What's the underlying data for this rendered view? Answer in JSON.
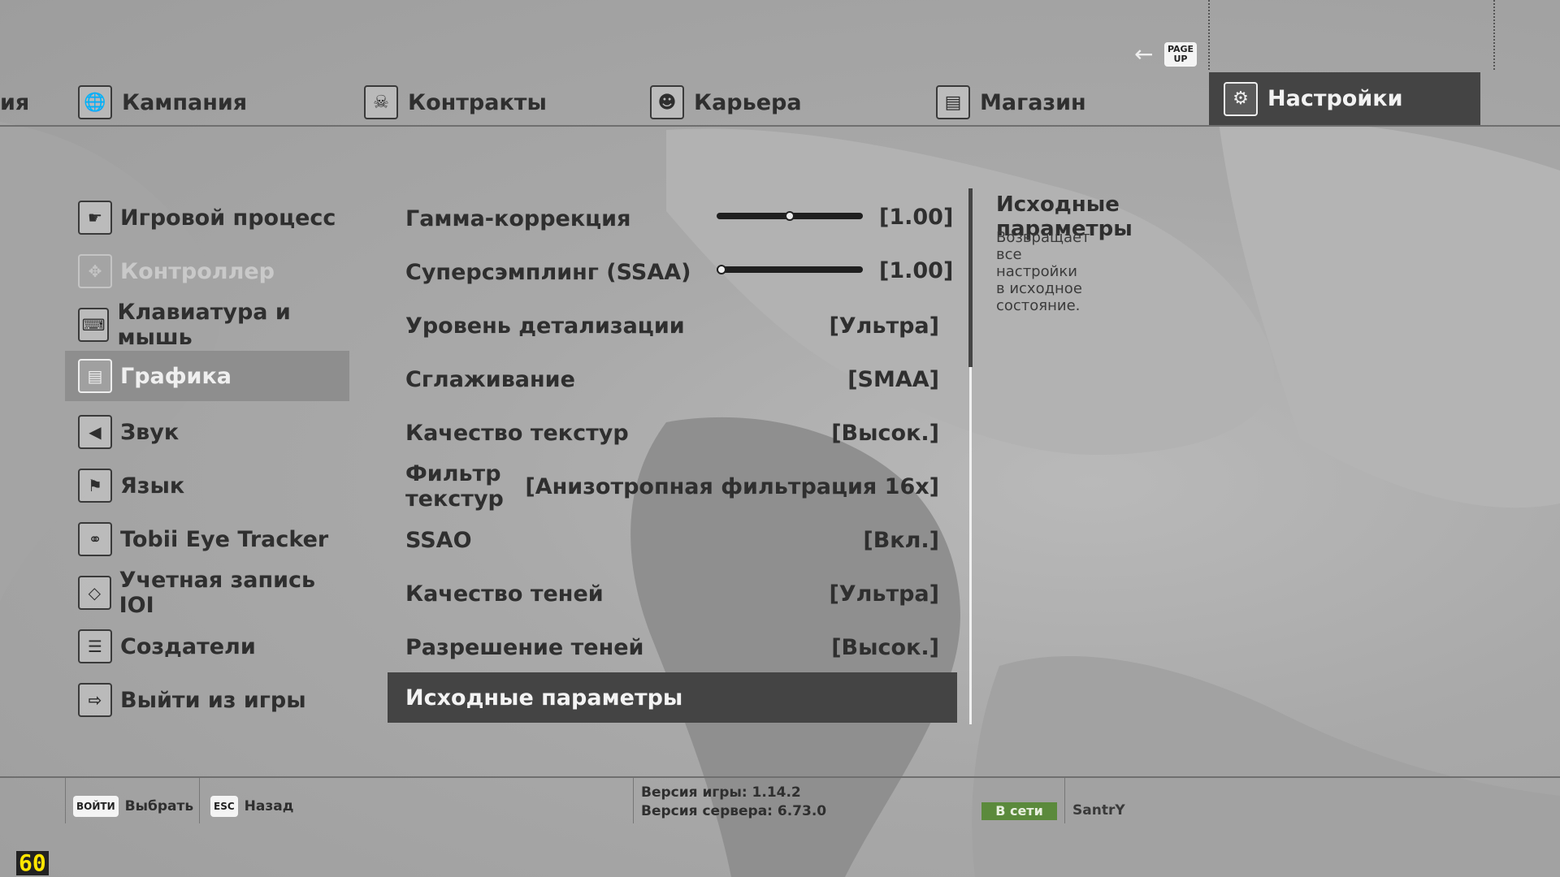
{
  "top_tabs": [
    {
      "label": "ия",
      "icon": "partial-tab"
    },
    {
      "label": "Кампания",
      "icon": "globe-icon"
    },
    {
      "label": "Контракты",
      "icon": "skull-icon"
    },
    {
      "label": "Карьера",
      "icon": "agent-icon"
    },
    {
      "label": "Магазин",
      "icon": "cart-icon"
    },
    {
      "label": "Настройки",
      "icon": "gear-icon",
      "active": true
    }
  ],
  "page_up_key": "PAGE UP",
  "menu": [
    {
      "label": "Игровой процесс",
      "icon": "pistol-icon"
    },
    {
      "label": "Контроллер",
      "icon": "controller-icon",
      "disabled": true
    },
    {
      "label": "Клавиатура и мышь",
      "icon": "keyboard-icon"
    },
    {
      "label": "Графика",
      "icon": "graphics-icon",
      "active": true
    },
    {
      "label": "Звук",
      "icon": "speaker-icon"
    },
    {
      "label": "Язык",
      "icon": "flag-icon"
    },
    {
      "label": "Tobii Eye Tracker",
      "icon": "eye-tracker-icon"
    },
    {
      "label": "Учетная запись IOI",
      "icon": "ioi-icon"
    },
    {
      "label": "Создатели",
      "icon": "credits-icon"
    },
    {
      "label": "Выйти из игры",
      "icon": "exit-icon"
    }
  ],
  "settings": [
    {
      "label": "Гамма-коррекция",
      "value": "[1.00]",
      "slider": 0.5
    },
    {
      "label": "Суперсэмплинг (SSAA)",
      "value": "[1.00]",
      "slider": 0.0
    },
    {
      "label": "Уровень детализации",
      "value": "[Ультра]"
    },
    {
      "label": "Сглаживание",
      "value": "[SMAA]"
    },
    {
      "label": "Качество текстур",
      "value": "[Высок.]"
    },
    {
      "label": "Фильтр текстур",
      "value": "[Анизотропная фильтрация 16x]"
    },
    {
      "label": "SSAO",
      "value": "[Вкл.]"
    },
    {
      "label": "Качество теней",
      "value": "[Ультра]"
    },
    {
      "label": "Разрешение теней",
      "value": "[Высок.]"
    },
    {
      "label": "Исходные параметры",
      "value": "",
      "active": true
    }
  ],
  "description": {
    "title": "Исходные параметры",
    "text": "Возвращает все настройки в исходное состояние."
  },
  "bottom": {
    "select_key": "ВОЙТИ",
    "select_label": "Выбрать",
    "back_key": "ESC",
    "back_label": "Назад",
    "game_version": "Версия игры: 1.14.2",
    "server_version": "Версия сервера: 6.73.0",
    "status": "В сети",
    "username": "SantrY"
  },
  "fps": "60",
  "colors": {
    "active_bg": "#444444",
    "online": "#5b8a3c",
    "fps": "#ffe600"
  }
}
